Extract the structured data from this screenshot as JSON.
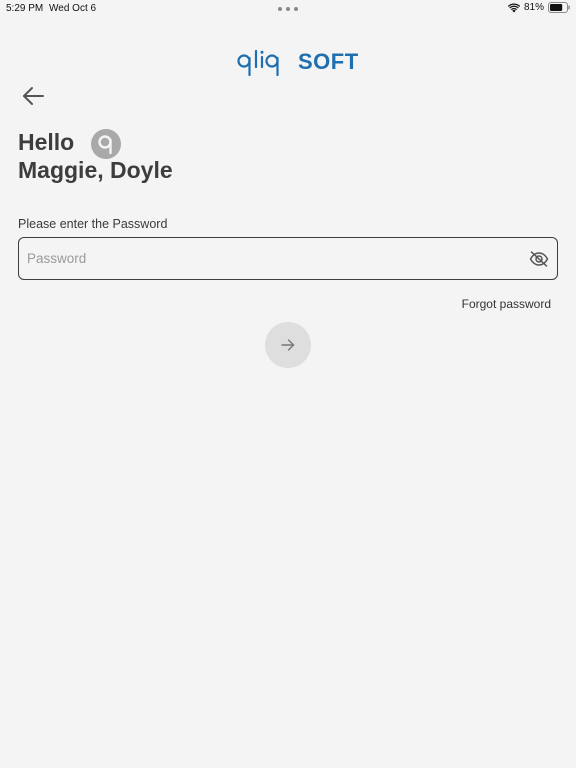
{
  "status_bar": {
    "time": "5:29 PM",
    "date": "Wed Oct 6",
    "battery_percent": "81%",
    "battery_level": 0.81,
    "icons": [
      "wifi-icon",
      "battery-icon"
    ]
  },
  "brand": {
    "logo_prefix": "qliq",
    "logo_suffix": "SOFT",
    "accent_color": "#1f6fb0"
  },
  "header": {
    "back_icon": "arrow-left-icon"
  },
  "greeting": {
    "hello": "Hello",
    "name": "Maggie, Doyle",
    "avatar_icon": "q-avatar-icon"
  },
  "password": {
    "label": "Please enter the Password",
    "value": "",
    "placeholder": "Password",
    "visibility_icon": "eye-off-icon"
  },
  "links": {
    "forgot_password": "Forgot password"
  },
  "submit": {
    "icon": "arrow-right-icon"
  }
}
